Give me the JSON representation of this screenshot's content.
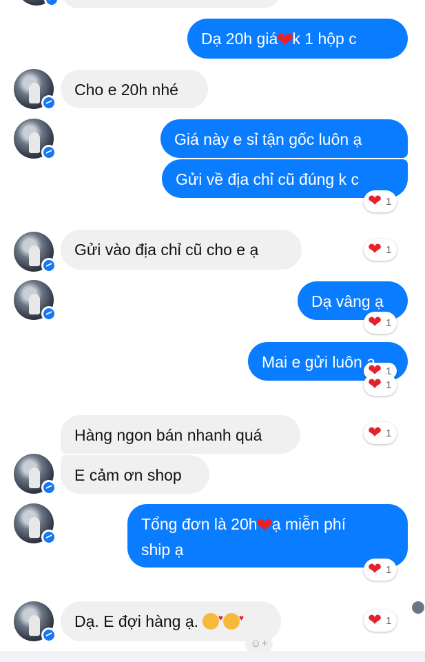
{
  "colors": {
    "outgoing": "#0a7cff",
    "incoming": "#f0f0f1",
    "heart": "#e5222c"
  },
  "messages": {
    "m1": {
      "pre": "Dạ 20h giá",
      "post": "k 1 hộp c"
    },
    "m2": "Cho e 20h nhé",
    "m3": "Giá này e sỉ tận gốc luôn ạ",
    "m4": "Gửi về địa chỉ cũ đúng k c",
    "m5": "Gửi vào địa chỉ cũ cho e ạ",
    "m6": "Dạ vâng ạ",
    "m7": "Mai e gửi luôn ạ",
    "m8": "Hàng ngon bán nhanh quá",
    "m9": "E cảm ơn shop",
    "m10": {
      "pre": "Tổng đơn là 20h",
      "post": "ạ miễn phí",
      "line2": "ship ạ"
    },
    "m11": "Dạ. E đợi hàng ạ."
  },
  "reactions": {
    "heart_symbol": "❤",
    "count": "1"
  },
  "icons": {
    "heart": "heart-icon",
    "messenger_badge": "messenger-badge-icon",
    "smiling_face_with_hearts": "smiling-face-with-hearts-icon",
    "add_reaction": "add-reaction-icon"
  },
  "add_reaction_label": "☺+"
}
